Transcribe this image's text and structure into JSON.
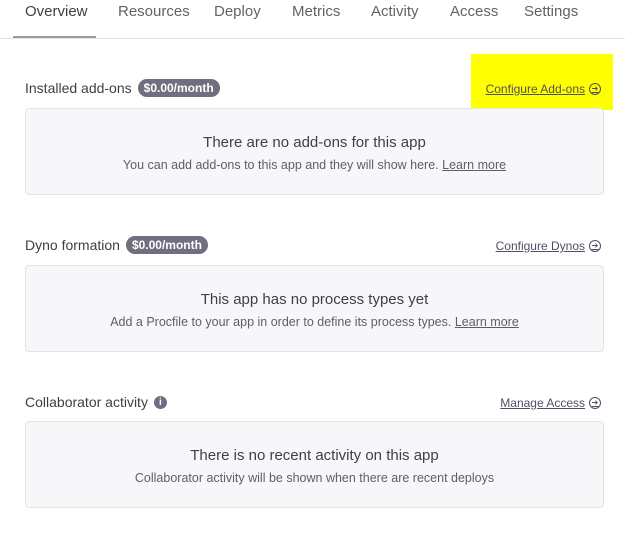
{
  "tabs": [
    "Overview",
    "Resources",
    "Deploy",
    "Metrics",
    "Activity",
    "Access",
    "Settings"
  ],
  "addons": {
    "title": "Installed add-ons",
    "badge": "$0.00/month",
    "link": "Configure Add-ons",
    "heading": "There are no add-ons for this app",
    "text": "You can add add-ons to this app and they will show here.",
    "learn": "Learn more"
  },
  "dynos": {
    "title": "Dyno formation",
    "badge": "$0.00/month",
    "link": "Configure Dynos",
    "heading": "This app has no process types yet",
    "text": "Add a Procfile to your app in order to define its process types.",
    "learn": "Learn more"
  },
  "collab": {
    "title": "Collaborator activity",
    "info": "i",
    "link": "Manage Access",
    "heading": "There is no recent activity on this app",
    "text": "Collaborator activity will be shown when there are recent deploys"
  },
  "arrow": "➔"
}
